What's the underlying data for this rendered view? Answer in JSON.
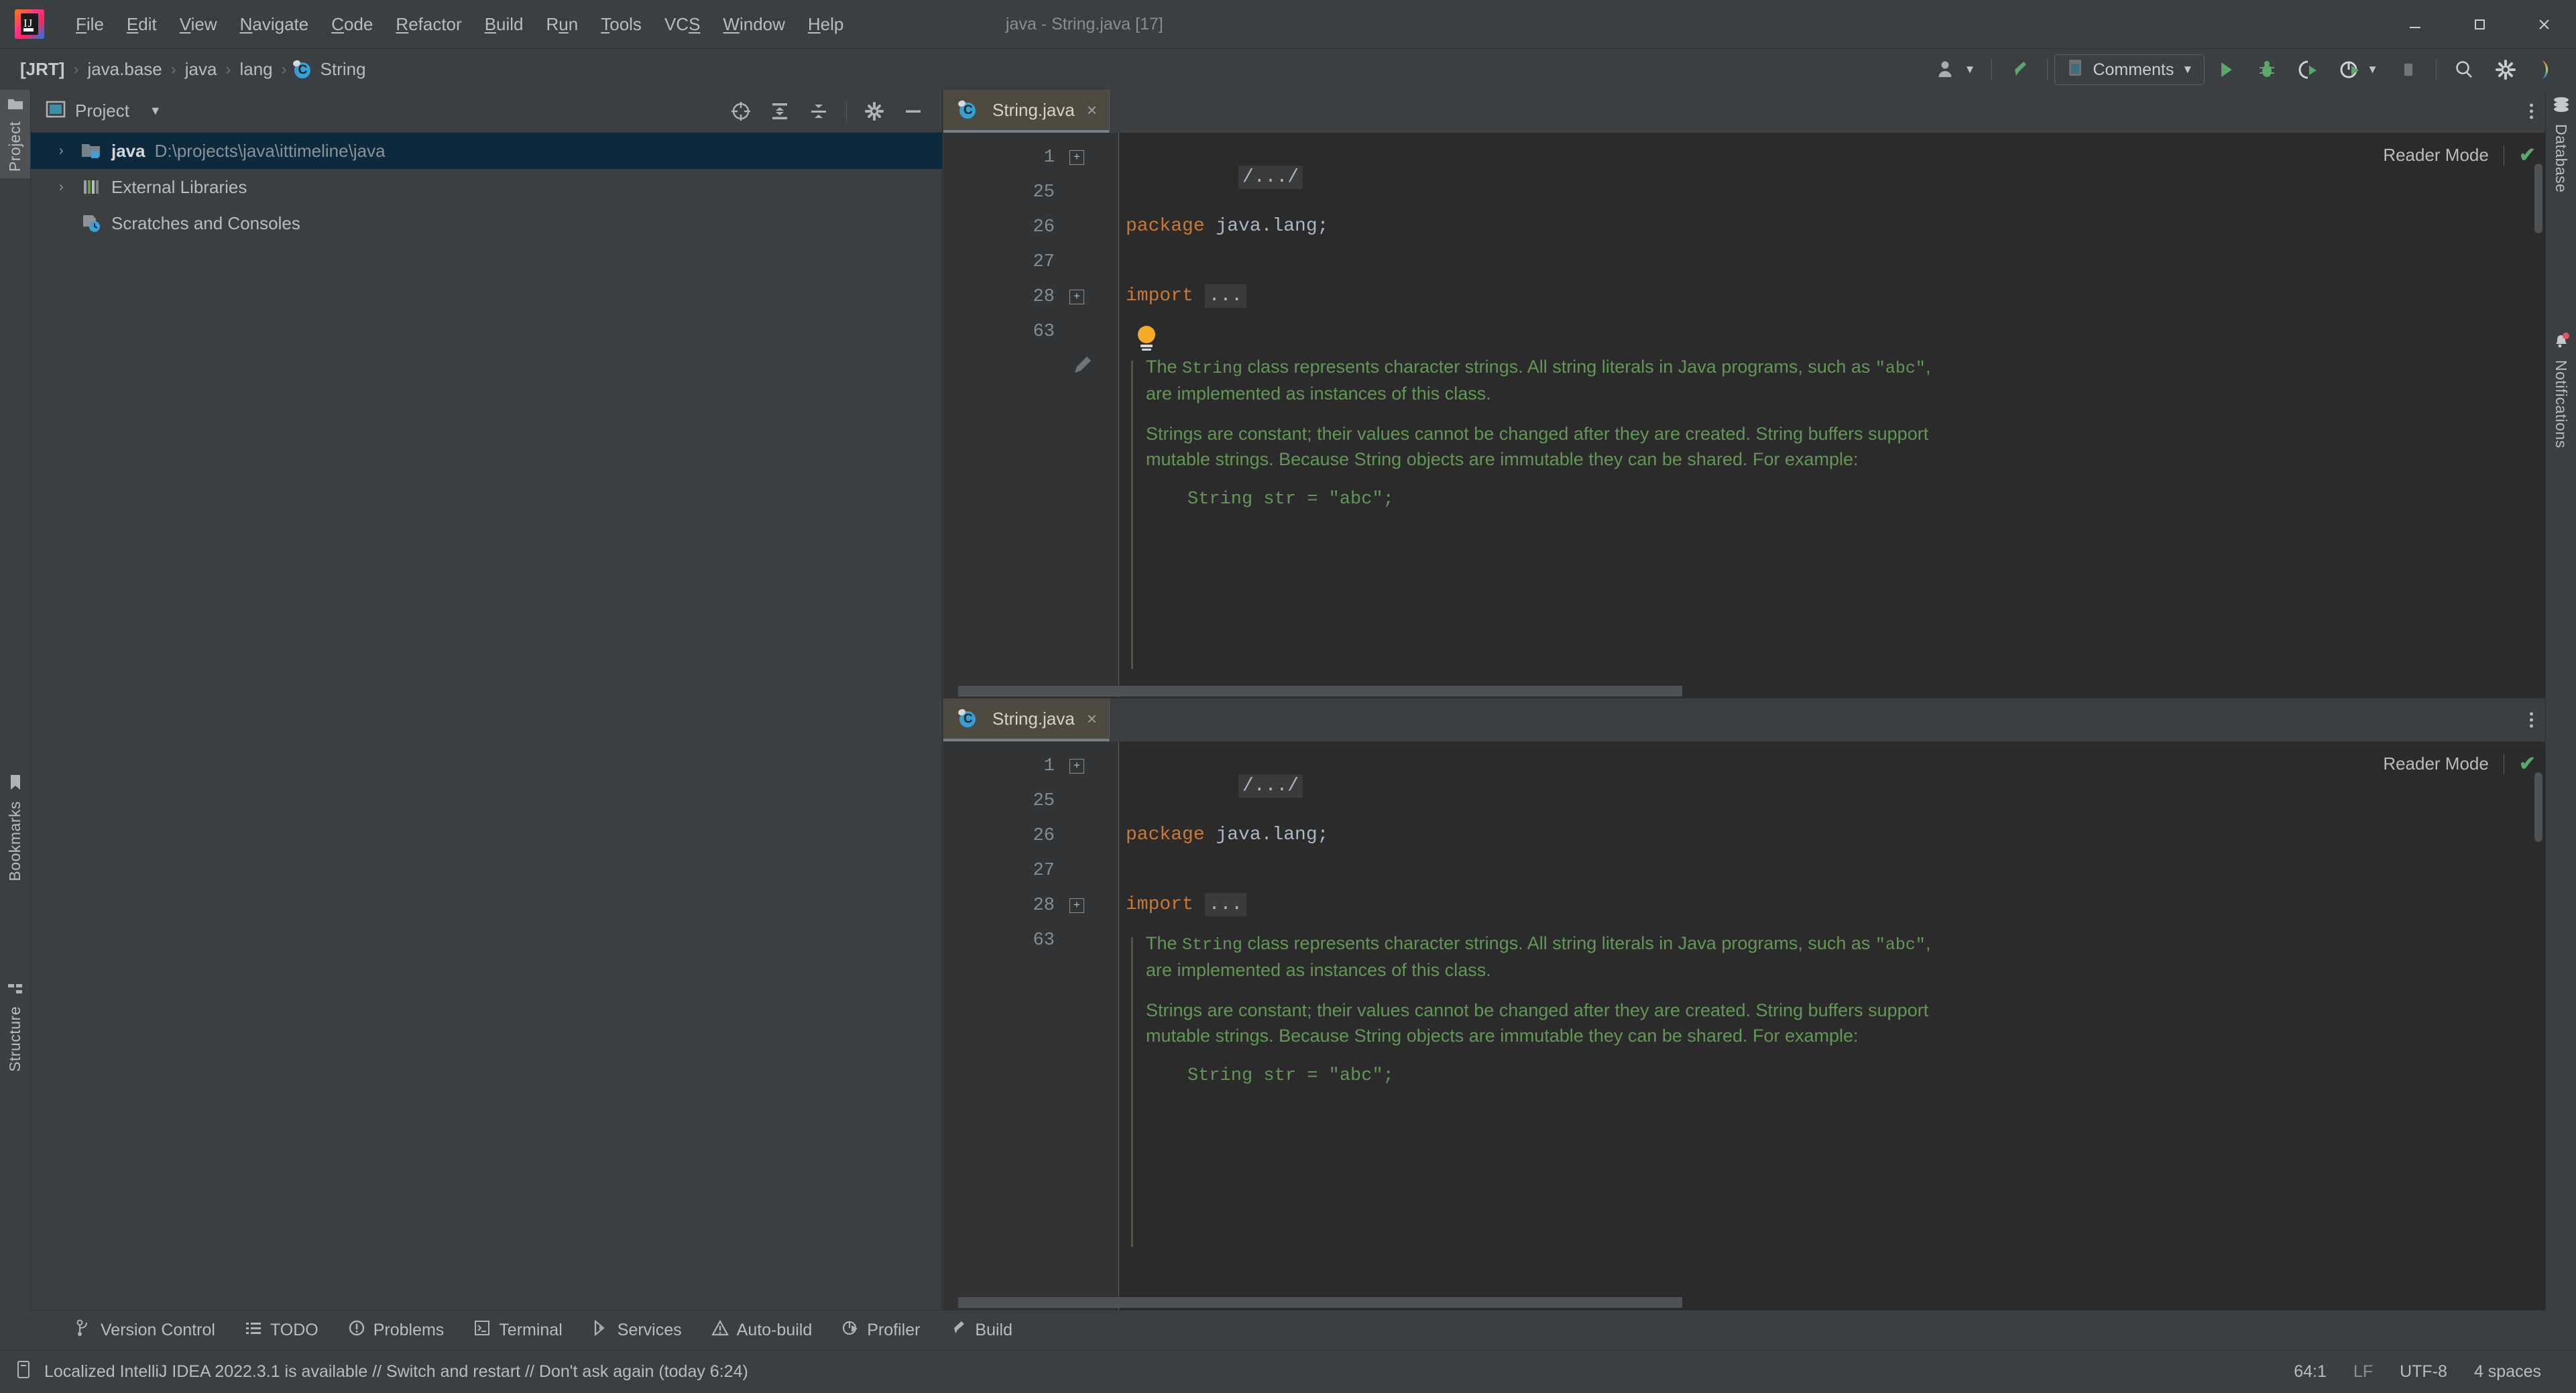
{
  "window": {
    "title": "java - String.java [17]",
    "controls": {
      "minimize": "minimize-icon",
      "maximize": "maximize-icon",
      "close": "close-icon"
    }
  },
  "menu": {
    "items": [
      {
        "label": "File",
        "mnemonic": "F"
      },
      {
        "label": "Edit",
        "mnemonic": "E"
      },
      {
        "label": "View",
        "mnemonic": "V"
      },
      {
        "label": "Navigate",
        "mnemonic": "N"
      },
      {
        "label": "Code",
        "mnemonic": "C"
      },
      {
        "label": "Refactor",
        "mnemonic": "R"
      },
      {
        "label": "Build",
        "mnemonic": "B"
      },
      {
        "label": "Run",
        "mnemonic": "u"
      },
      {
        "label": "Tools",
        "mnemonic": "T"
      },
      {
        "label": "VCS",
        "mnemonic": "S"
      },
      {
        "label": "Window",
        "mnemonic": "W"
      },
      {
        "label": "Help",
        "mnemonic": "H"
      }
    ]
  },
  "navbar": {
    "crumbs": [
      {
        "label": "[JRT]",
        "bold": true,
        "icon": null
      },
      {
        "label": "java.base",
        "bold": false,
        "icon": null
      },
      {
        "label": "java",
        "bold": false,
        "icon": null
      },
      {
        "label": "lang",
        "bold": false,
        "icon": null
      },
      {
        "label": "String",
        "bold": false,
        "icon": "java-class-icon"
      }
    ],
    "separator": "›",
    "right": {
      "account": "account-icon",
      "account_chevron": "chevron-down-icon",
      "build_icon": "build-hammer-icon",
      "comments_label": "Comments",
      "comments_chevron": "chevron-down-icon",
      "run": "run-play-icon",
      "debug": "debug-bug-icon",
      "run_coverage": "run-with-coverage-icon",
      "profile": "profiler-icon",
      "profile_chevron": "chevron-down-icon",
      "stop": "stop-icon",
      "search": "search-icon",
      "settings": "gear-icon",
      "ide_assistant": "ide-assistant-icon"
    }
  },
  "left_stripe": {
    "items": [
      {
        "label": "Project",
        "icon": "project-folder-icon",
        "active": true
      },
      {
        "label": "Bookmarks",
        "icon": "bookmark-icon",
        "active": false
      },
      {
        "label": "Structure",
        "icon": "structure-icon",
        "active": false
      }
    ]
  },
  "right_stripe": {
    "items": [
      {
        "label": "Database",
        "icon": "database-icon"
      },
      {
        "label": "Notifications",
        "icon": "notifications-bell-icon"
      }
    ]
  },
  "project_panel": {
    "title": "Project",
    "title_icon": "project-window-icon",
    "title_chevron": "chevron-down-icon",
    "toolbar": [
      {
        "name": "select-opened-file-icon"
      },
      {
        "name": "expand-all-icon"
      },
      {
        "name": "collapse-all-icon"
      },
      {
        "name": "gear-icon"
      },
      {
        "name": "hide-icon"
      }
    ],
    "tree": [
      {
        "label": "java",
        "sub": "D:\\projects\\java\\ittimeline\\java",
        "icon": "module-folder-icon",
        "arrow": "›",
        "selected": true,
        "bold": true
      },
      {
        "label": "External Libraries",
        "sub": "",
        "icon": "libraries-icon",
        "arrow": "›",
        "selected": false,
        "bold": false
      },
      {
        "label": "Scratches and Consoles",
        "sub": "",
        "icon": "scratches-icon",
        "arrow": "",
        "selected": false,
        "bold": false
      }
    ]
  },
  "editor": {
    "panes": [
      {
        "tab": {
          "label": "String.java",
          "icon": "java-class-icon",
          "close": "×"
        },
        "kebab": "more-options-icon",
        "reader_mode": {
          "label": "Reader Mode",
          "check": "✔"
        },
        "line_numbers": [
          "1",
          "25",
          "26",
          "27",
          "28",
          "63"
        ],
        "code": {
          "line1": "/.../",
          "line26_kw": "package",
          "line26_rest": " java.lang;",
          "line28_kw": "import",
          "line28_ph": "..."
        },
        "javadoc": {
          "p1_a": "The ",
          "p1_code": "String",
          "p1_b": " class represents character strings. All string literals in Java programs, such as ",
          "p1_code2": "\"abc\"",
          "p1_c": ", are implemented as instances of this class.",
          "p2": "Strings are constant; their values cannot be changed after they are created. String buffers support mutable strings. Because String objects are immutable they can be shared. For example:",
          "sample": "String str = \"abc\";"
        },
        "gutter_pencil": "edit-pencil-icon",
        "bulb": "intention-bulb-icon"
      },
      {
        "tab": {
          "label": "String.java",
          "icon": "java-class-icon",
          "close": "×"
        },
        "kebab": "more-options-icon",
        "reader_mode": {
          "label": "Reader Mode",
          "check": "✔"
        },
        "line_numbers": [
          "1",
          "25",
          "26",
          "27",
          "28",
          "63"
        ],
        "code": {
          "line1": "/.../",
          "line26_kw": "package",
          "line26_rest": " java.lang;",
          "line28_kw": "import",
          "line28_ph": "..."
        },
        "javadoc": {
          "p1_a": "The ",
          "p1_code": "String",
          "p1_b": " class represents character strings. All string literals in Java programs, such as ",
          "p1_code2": "\"abc\"",
          "p1_c": ", are implemented as instances of this class.",
          "p2": "Strings are constant; their values cannot be changed after they are created. String buffers support mutable strings. Because String objects are immutable they can be shared. For example:",
          "sample": "String str = \"abc\";"
        },
        "gutter_pencil": "",
        "bulb": ""
      }
    ]
  },
  "bottom_bar": {
    "items": [
      {
        "label": "Version Control",
        "icon": "version-control-icon"
      },
      {
        "label": "TODO",
        "icon": "todo-list-icon"
      },
      {
        "label": "Problems",
        "icon": "problems-icon"
      },
      {
        "label": "Terminal",
        "icon": "terminal-icon"
      },
      {
        "label": "Services",
        "icon": "services-icon"
      },
      {
        "label": "Auto-build",
        "icon": "auto-build-icon"
      },
      {
        "label": "Profiler",
        "icon": "profiler-icon"
      },
      {
        "label": "Build",
        "icon": "build-hammer-icon"
      }
    ]
  },
  "status_bar": {
    "message_icon": "notification-doc-icon",
    "message": "Localized IntelliJ IDEA 2022.3.1 is available // Switch and restart // Don't ask again (today 6:24)",
    "caret": "64:1",
    "line_separator": "LF",
    "encoding": "UTF-8",
    "indent": "4 spaces"
  },
  "colors": {
    "chrome": "#3c3f41",
    "editor_bg": "#2b2b2b",
    "gutter_bg": "#313335",
    "selection": "#0d293e",
    "tab_active": "#4e4a3f",
    "keyword": "#cc7832",
    "javadoc": "#629755",
    "text": "#bbbbbb",
    "accent_green": "#59a869",
    "accent_blue": "#389fd6",
    "bulb": "#f5ab25"
  }
}
